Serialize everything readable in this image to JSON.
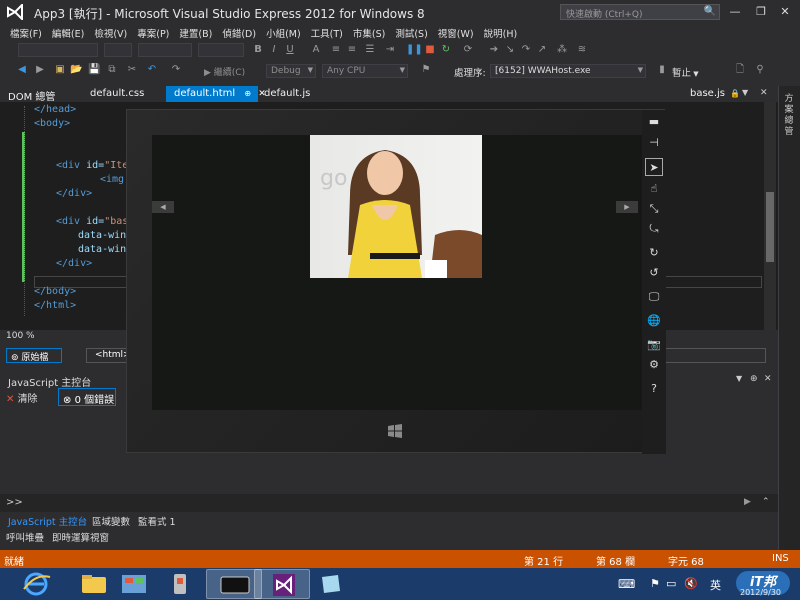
{
  "window": {
    "title": "App3 [執行] - Microsoft Visual Studio Express 2012 for Windows 8",
    "quick_launch_placeholder": "快速啟動 (Ctrl+Q)"
  },
  "menu": [
    "檔案(F)",
    "編輯(E)",
    "檢視(V)",
    "專案(P)",
    "建置(B)",
    "偵錯(D)",
    "小組(M)",
    "工具(T)",
    "市集(S)",
    "測試(S)",
    "視窗(W)",
    "說明(H)"
  ],
  "toolbar": {
    "continue_label": "繼續(C)",
    "config": "Debug",
    "platform": "Any CPU",
    "process_label": "處理序:",
    "process_value": "[6152] WWAHost.exe",
    "suspend_label": "暫止"
  },
  "tabs": {
    "dom_explorer": "DOM 總管",
    "css": "default.css",
    "html": "default.html",
    "js": "default.js",
    "right_file": "base.js",
    "right_strip_text": "方案總管"
  },
  "code": {
    "l1_head_close": "</head>",
    "l2_body_open": "<body>",
    "l3_div_open": "<div",
    "l3_id_attr": "id=",
    "l3_id_val": "\"Item",
    "l4_img": "<img",
    "l5_div_close": "</div>",
    "l6_div_open": "<div",
    "l6_id_attr": "id=",
    "l6_id_val": "\"basi",
    "l7": "data-win-",
    "l8": "data-win-",
    "l9_div_close": "</div>",
    "l10_body_close": "</body>",
    "l11_html_close": "</html>"
  },
  "zoom": "100 %",
  "nav": {
    "source_label": "原始檔",
    "html_crumb": "<html>"
  },
  "console": {
    "title": "JavaScript 主控台",
    "clear_label": "清除",
    "errors_label": "0 個錯誤",
    "prompt": ">>"
  },
  "bottom_tabs": {
    "row1": [
      "JavaScript 主控台",
      "區域變數",
      "監看式 1"
    ],
    "row2": [
      "呼叫堆疊",
      "即時運算視窗"
    ]
  },
  "status": {
    "ready": "就緒",
    "line": "第 21 行",
    "col": "第 68 欄",
    "char": "字元 68",
    "mode": "INS"
  },
  "tray": {
    "ime": "英",
    "clock_date": "2012/9/30"
  },
  "colors": {
    "accent": "#007acc",
    "status_bar": "#ca5100",
    "taskbar": "#1b3c6b"
  }
}
